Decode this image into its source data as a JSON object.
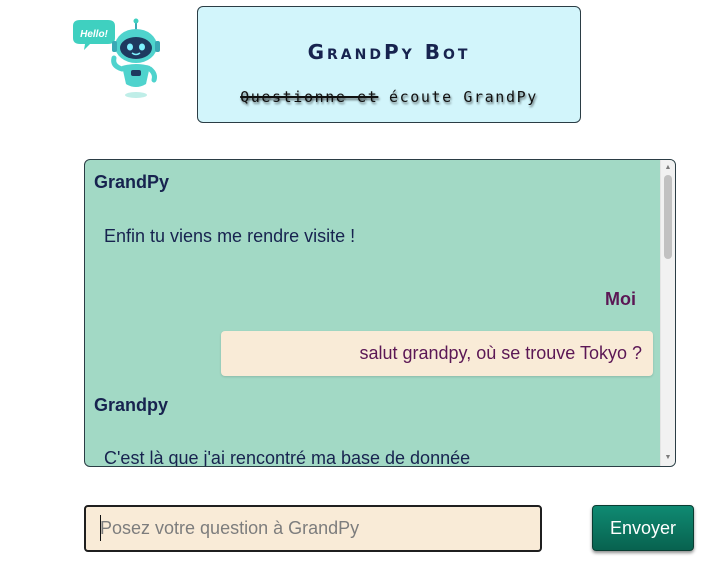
{
  "logo": {
    "speech_bubble_text": "Hello!",
    "icon": "robot-hello-icon"
  },
  "header": {
    "title": "GrandPy Bot",
    "subtitle_struck": "Questionne et",
    "subtitle_rest": "écoute GrandPy"
  },
  "chat": {
    "messages": [
      {
        "sender": "GrandPy",
        "text": "Enfin tu viens me rendre visite !",
        "from": "bot"
      },
      {
        "sender": "Moi",
        "text": "salut grandpy, où se trouve Tokyo ?",
        "from": "user"
      },
      {
        "sender": "Grandpy",
        "text": "C'est là que j'ai rencontré ma base de donnée",
        "from": "bot"
      }
    ]
  },
  "input": {
    "placeholder": "Posez votre question à GrandPy",
    "value": ""
  },
  "send_button": {
    "label": "Envoyer"
  },
  "colors": {
    "header_bg": "#d2f5fb",
    "chat_bg": "#a2d9c5",
    "bubble_bg": "#f9ebd7",
    "bot_text": "#17234f",
    "user_text": "#5b1755",
    "button_bg": "#0f8a72"
  }
}
